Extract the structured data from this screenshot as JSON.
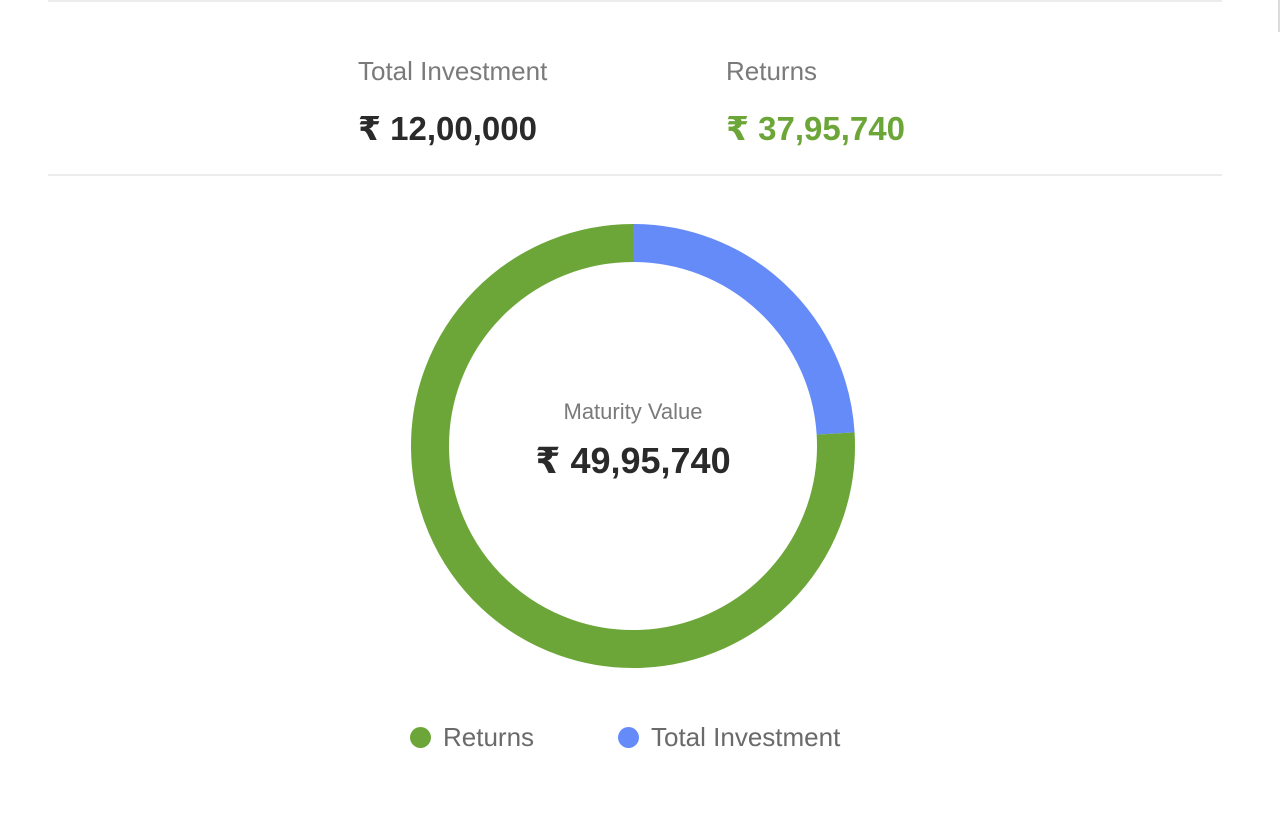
{
  "summary": {
    "investment": {
      "label": "Total Investment",
      "value": "₹ 12,00,000"
    },
    "returns": {
      "label": "Returns",
      "value": "₹ 37,95,740"
    }
  },
  "donut": {
    "center_label": "Maturity Value",
    "center_value": "₹ 49,95,740"
  },
  "legend": {
    "returns": "Returns",
    "investment": "Total Investment"
  },
  "colors": {
    "returns": "#6da638",
    "investment": "#648bf8"
  },
  "chart_data": {
    "type": "pie",
    "series": [
      {
        "name": "Total Investment",
        "value": 1200000,
        "color": "#648bf8"
      },
      {
        "name": "Returns",
        "value": 3795740,
        "color": "#6da638"
      }
    ],
    "total": 4995740,
    "center_text": "Maturity Value",
    "legend": "bottom"
  }
}
